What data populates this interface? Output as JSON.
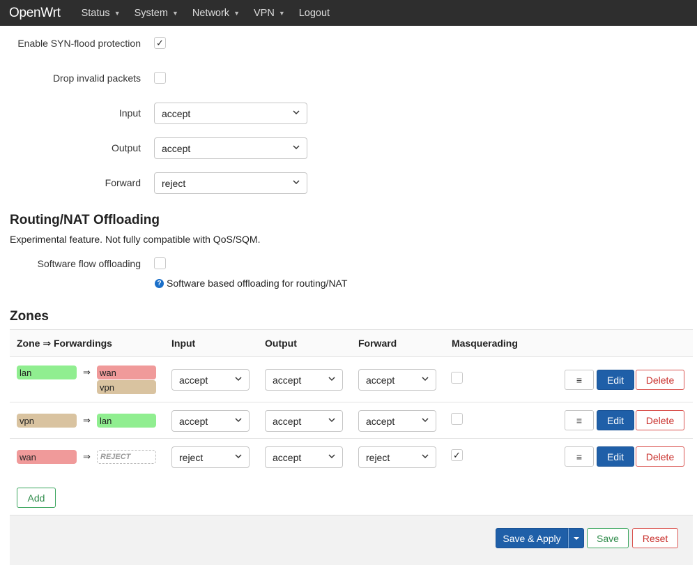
{
  "nav": {
    "brand": "OpenWrt",
    "menu": [
      "Status",
      "System",
      "Network",
      "VPN"
    ],
    "logout": "Logout"
  },
  "general": {
    "syn_flood_label": "Enable SYN-flood protection",
    "syn_flood_checked": "✓",
    "drop_invalid_label": "Drop invalid packets",
    "input_label": "Input",
    "input_value": "accept",
    "output_label": "Output",
    "output_value": "accept",
    "forward_label": "Forward",
    "forward_value": "reject"
  },
  "offloading": {
    "title": "Routing/NAT Offloading",
    "description": "Experimental feature. Not fully compatible with QoS/SQM.",
    "software_label": "Software flow offloading",
    "hint": "Software based offloading for routing/NAT"
  },
  "zones": {
    "title": "Zones",
    "headers": [
      "Zone ⇒ Forwardings",
      "Input",
      "Output",
      "Forward",
      "Masquerading"
    ],
    "arrow": "⇒",
    "rows": [
      {
        "zone": "lan",
        "zone_color": "#90ee90",
        "forwardings": [
          {
            "name": "wan",
            "color": "#f09a9a"
          },
          {
            "name": "vpn",
            "color": "#d9c3a0"
          }
        ],
        "input": "accept",
        "output": "accept",
        "forward": "accept",
        "masq": ""
      },
      {
        "zone": "vpn",
        "zone_color": "#d9c3a0",
        "forwardings": [
          {
            "name": "lan",
            "color": "#90ee90"
          }
        ],
        "input": "accept",
        "output": "accept",
        "forward": "accept",
        "masq": ""
      },
      {
        "zone": "wan",
        "zone_color": "#f09a9a",
        "forwardings": [
          {
            "name": "REJECT",
            "color": ""
          }
        ],
        "input": "reject",
        "output": "accept",
        "forward": "reject",
        "masq": "✓"
      }
    ],
    "menu_glyph": "≡",
    "edit_label": "Edit",
    "delete_label": "Delete",
    "add_label": "Add"
  },
  "actions": {
    "save_apply": "Save & Apply",
    "save": "Save",
    "reset": "Reset"
  },
  "colors": {
    "primary": "#1f5fa8",
    "success": "#3aa55d",
    "danger": "#d9534f",
    "navbar": "#2e2e2e"
  }
}
